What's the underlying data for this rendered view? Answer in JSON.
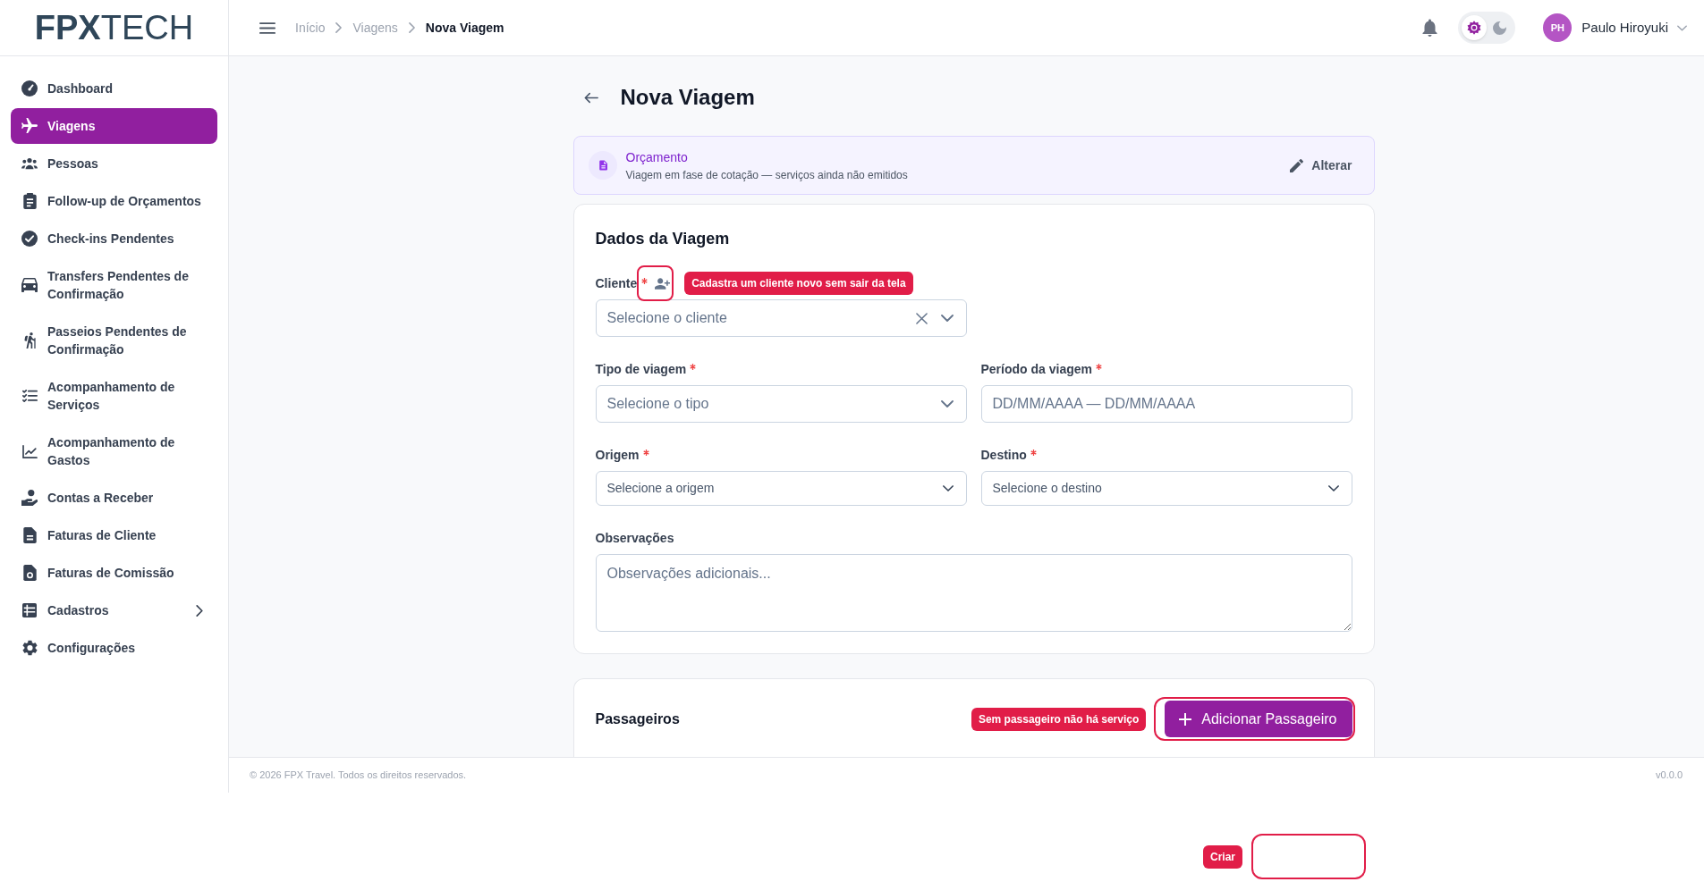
{
  "sidebar": {
    "logo": "**FPX**TECH",
    "items": [
      {
        "label": "Dashboard",
        "selected": false
      },
      {
        "label": "Viagens",
        "selected": true
      },
      {
        "label": "Pessoas",
        "selected": false
      },
      {
        "label": "Follow-up de Orçamentos",
        "selected": false
      },
      {
        "label": "Check-ins Pendentes",
        "selected": false
      },
      {
        "label": "Transfers Pendentes de Confirmação",
        "selected": false
      },
      {
        "label": "Passeios Pendentes de Confirmação",
        "selected": false
      },
      {
        "label": "Acompanhamento de Serviços",
        "selected": false
      },
      {
        "label": "Acompanhamento de Gastos",
        "selected": false
      },
      {
        "label": "Contas a Receber",
        "selected": false
      },
      {
        "label": "Faturas de Cliente",
        "selected": false
      },
      {
        "label": "Faturas de Comissão",
        "selected": false
      },
      {
        "label": "Cadastros",
        "selected": false,
        "expanded": false
      },
      {
        "label": "Configurações",
        "selected": false
      }
    ]
  },
  "topbar": {
    "breadcrumbs": [
      {
        "label": "Início",
        "current": false
      },
      {
        "label": "Viagens",
        "current": false
      },
      {
        "label": "Nova Viagem",
        "current": true
      }
    ],
    "theme_options": [
      {
        "kind": "light",
        "selected": true
      },
      {
        "kind": "dark",
        "selected": false
      }
    ],
    "user": {
      "initials": "PH",
      "name": "Paulo Hiroyuki"
    }
  },
  "page": {
    "title": "Nova Viagem"
  },
  "status": {
    "title": "Orçamento",
    "description": "Viagem em fase de cotação — serviços ainda não emitidos",
    "action": "Alterar"
  },
  "trip_form": {
    "title": "Dados da Viagem",
    "rows": [
      {
        "fields": [
          {
            "kind": "client-select",
            "label": "Cliente",
            "required": true,
            "placeholder": "Selecione o cliente",
            "add_client": {
              "highlighted": true,
              "annotation": "Cadastra um cliente novo sem sair da tela"
            }
          }
        ]
      },
      {
        "fields": [
          {
            "kind": "select",
            "label": "Tipo de viagem",
            "required": true,
            "placeholder": "Selecione o tipo"
          },
          {
            "kind": "date-range",
            "label": "Período da viagem",
            "required": true,
            "placeholder": "DD/MM/AAAA — DD/MM/AAAA"
          }
        ]
      },
      {
        "fields": [
          {
            "kind": "place-select",
            "label": "Origem",
            "required": true,
            "placeholder": "Selecione a origem"
          },
          {
            "kind": "place-select",
            "label": "Destino",
            "required": true,
            "placeholder": "Selecione o destino"
          }
        ]
      },
      {
        "fields": [
          {
            "kind": "textarea",
            "label": "Observações",
            "required": false,
            "placeholder": "Observações adicionais..."
          }
        ]
      }
    ]
  },
  "passengers": {
    "title": "Passageiros",
    "annotation": "Sem passageiro não há serviço",
    "button": {
      "label": "Adicionar Passageiro",
      "highlighted": true
    }
  },
  "footer": {
    "copyright": "© 2026 FPX Travel. Todos os direitos reservados.",
    "version": "v0.0.0"
  },
  "create_hint": {
    "annotation": "Criar",
    "highlighted": true
  }
}
